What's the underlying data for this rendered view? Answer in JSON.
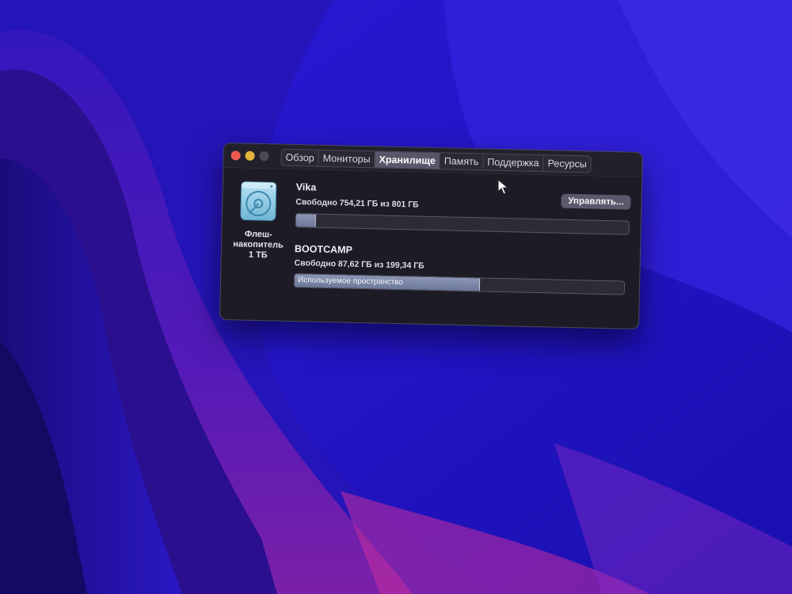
{
  "window": {
    "tabs": [
      {
        "label": "Обзор",
        "active": false
      },
      {
        "label": "Мониторы",
        "active": false
      },
      {
        "label": "Хранилище",
        "active": true
      },
      {
        "label": "Память",
        "active": false
      },
      {
        "label": "Поддержка",
        "active": false
      },
      {
        "label": "Ресурсы",
        "active": false
      }
    ]
  },
  "drive": {
    "icon": "hard-drive-icon",
    "label_line1": "Флеш-",
    "label_line2": "накопитель",
    "label_line3": "1 ТБ"
  },
  "volumes": [
    {
      "name": "Vika",
      "free_text": "Свободно 754,21 ГБ из 801 ГБ",
      "used_fraction": 0.058,
      "manage_label": "Управлять..."
    },
    {
      "name": "BOOTCAMP",
      "free_text": "Свободно 87,62 ГБ из 199,34 ГБ",
      "used_fraction": 0.56,
      "bar_label": "Используемое пространство"
    }
  ],
  "colors": {
    "wallpaper_base": "#2a16c9",
    "window_bg": "#1d1c26",
    "close": "#ec5a52",
    "minimize": "#e4b43b",
    "bar_fill": "#7b86a6"
  }
}
